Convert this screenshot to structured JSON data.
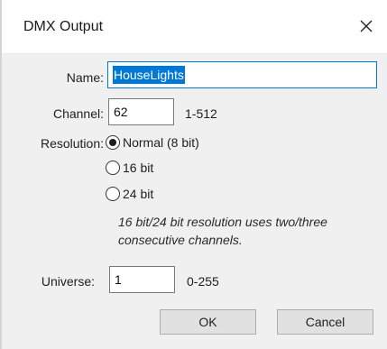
{
  "dialog": {
    "title": "DMX Output",
    "close_icon": "close-icon"
  },
  "name": {
    "label": "Name:",
    "value": "HouseLights"
  },
  "channel": {
    "label": "Channel:",
    "value": "62",
    "range": "1-512"
  },
  "resolution": {
    "label": "Resolution:",
    "options": [
      {
        "label": "Normal (8 bit)",
        "checked": true
      },
      {
        "label": "16 bit",
        "checked": false
      },
      {
        "label": "24 bit",
        "checked": false
      }
    ],
    "note_line1": "16 bit/24 bit resolution uses two/three",
    "note_line2": "consecutive channels."
  },
  "universe": {
    "label": "Universe:",
    "value": "1",
    "range": "0-255"
  },
  "buttons": {
    "ok": "OK",
    "cancel": "Cancel"
  },
  "colors": {
    "accent": "#0078d7",
    "dialog_bg": "#f0f0f0",
    "titlebar_bg": "#ffffff"
  }
}
